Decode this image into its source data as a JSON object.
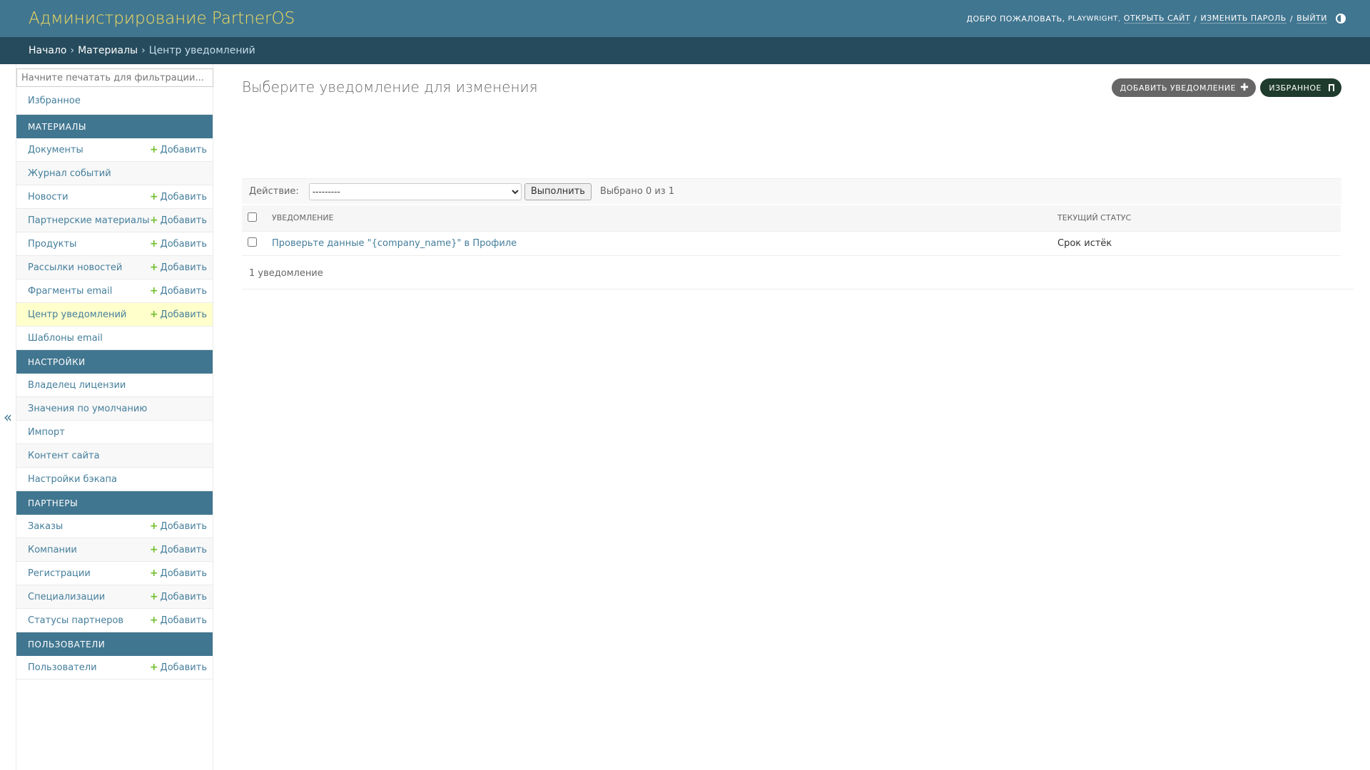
{
  "header": {
    "title": "Администрирование PartnerOS",
    "welcome": "Добро пожаловать,",
    "username": "PLAYWRIGHT",
    "view_site": "Открыть сайт",
    "change_password": "Изменить пароль",
    "logout": "Выйти"
  },
  "breadcrumbs": {
    "home": "Начало",
    "app": "Материалы",
    "current": "Центр уведомлений"
  },
  "sidebar": {
    "filter_placeholder": "Начните печатать для фильтрации...",
    "favorites": "Избранное",
    "add_label": "Добавить",
    "sections": [
      {
        "caption": "Материалы",
        "items": [
          {
            "label": "Документы",
            "add": true
          },
          {
            "label": "Журнал событий",
            "add": false
          },
          {
            "label": "Новости",
            "add": true
          },
          {
            "label": "Партнерские материалы",
            "add": true
          },
          {
            "label": "Продукты",
            "add": true
          },
          {
            "label": "Рассылки новостей",
            "add": true
          },
          {
            "label": "Фрагменты email",
            "add": true
          },
          {
            "label": "Центр уведомлений",
            "add": true,
            "current": true
          },
          {
            "label": "Шаблоны email",
            "add": false
          }
        ]
      },
      {
        "caption": "Настройки",
        "items": [
          {
            "label": "Владелец лицензии",
            "add": false
          },
          {
            "label": "Значения по умолчанию",
            "add": false
          },
          {
            "label": "Импорт",
            "add": false
          },
          {
            "label": "Контент сайта",
            "add": false
          },
          {
            "label": "Настройки бэкапа",
            "add": false
          }
        ]
      },
      {
        "caption": "Партнеры",
        "items": [
          {
            "label": "Заказы",
            "add": true
          },
          {
            "label": "Компании",
            "add": true
          },
          {
            "label": "Регистрации",
            "add": true
          },
          {
            "label": "Специализации",
            "add": true
          },
          {
            "label": "Статусы партнеров",
            "add": true
          }
        ]
      },
      {
        "caption": "Пользователи",
        "items": [
          {
            "label": "Пользователи",
            "add": true
          }
        ]
      }
    ]
  },
  "content": {
    "title": "Выберите уведомление для изменения",
    "add_button": "Добавить уведомление",
    "favorites_button": "Избранное",
    "action_label": "Действие:",
    "action_selected": "---------",
    "run_button": "Выполнить",
    "selected_counter": "Выбрано 0 из 1",
    "columns": [
      "Уведомление",
      "Текущий статус"
    ],
    "rows": [
      {
        "notification": "Проверьте данные \"{company_name}\" в Профиле",
        "status": "Срок истёк"
      }
    ],
    "paginator": "1 уведомление"
  },
  "colors": {
    "header_bg": "#417690",
    "breadcrumbs_bg": "#264b5d",
    "brand_text": "#f5dd5d",
    "link": "#447e9b",
    "add_icon": "#70bf2b",
    "current_row_bg": "#ffffcc"
  }
}
